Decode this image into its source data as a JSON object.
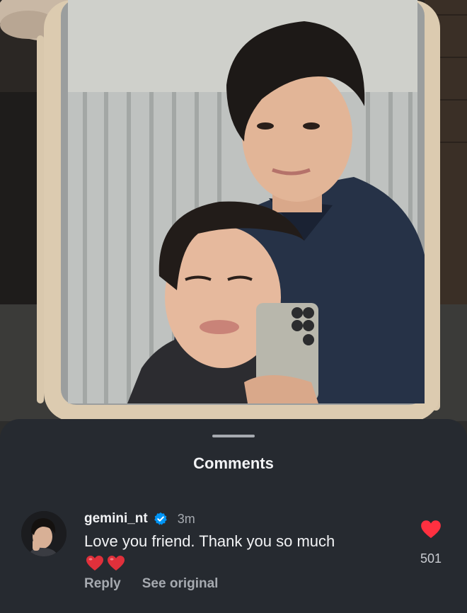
{
  "sheet": {
    "title": "Comments"
  },
  "comment": {
    "username": "gemini_nt",
    "verified": true,
    "time": "3m",
    "text": "Love you friend. Thank you so much",
    "emojis": [
      "red-heart",
      "red-heart"
    ],
    "reply_label": "Reply",
    "see_original_label": "See original",
    "like_count": "501"
  },
  "colors": {
    "sheet_bg": "#262a30",
    "like_red": "#ff3040",
    "verified_blue": "#0095f6",
    "muted_text": "#a6aab0"
  }
}
